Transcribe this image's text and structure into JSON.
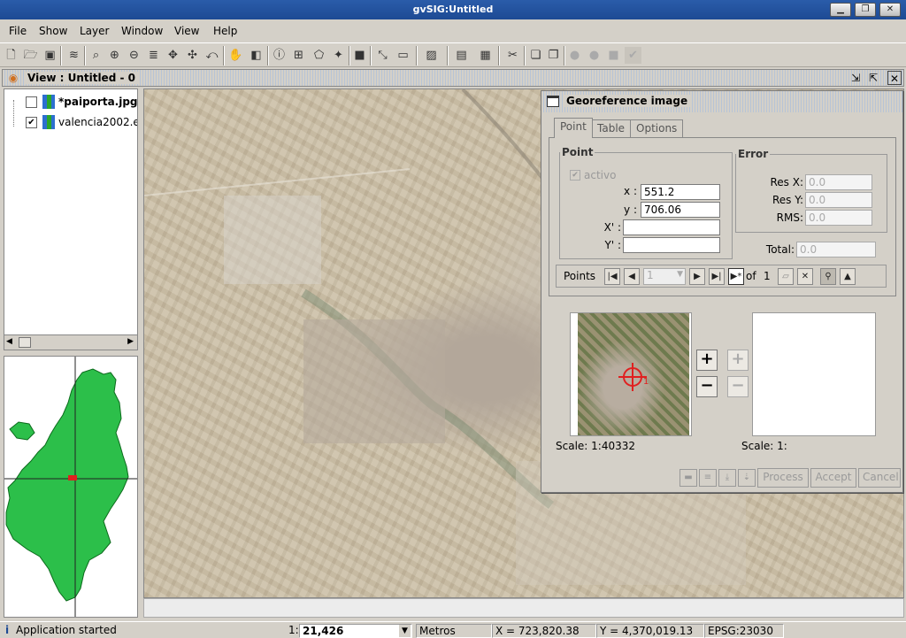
{
  "window": {
    "title": "gvSIG:Untitled",
    "controls": [
      "minimize-icon",
      "restore-icon",
      "close-icon"
    ]
  },
  "menu": {
    "items": [
      "File",
      "Show",
      "Layer",
      "Window",
      "View",
      "Help"
    ]
  },
  "view": {
    "title": "View : Untitled - 0"
  },
  "toc": {
    "layers": [
      {
        "name": "*paiporta.jpg",
        "checked": false,
        "bold": true
      },
      {
        "name": "valencia2002.e",
        "checked": true,
        "bold": false
      }
    ]
  },
  "georef": {
    "title": "Georeference image",
    "tabs": [
      "Point",
      "Table",
      "Options"
    ],
    "active_tab": "Point",
    "point": {
      "legend": "Point",
      "activo_label": "activo",
      "x_label": "x :",
      "x_value": "551.2",
      "y_label": "y :",
      "y_value": "706.06",
      "xp_label": "X' :",
      "xp_value": "",
      "yp_label": "Y' :",
      "yp_value": ""
    },
    "error": {
      "legend": "Error",
      "resx_label": "Res X:",
      "resx_value": "0.0",
      "resy_label": "Res Y:",
      "resy_value": "0.0",
      "rms_label": "RMS:",
      "rms_value": "0.0",
      "total_label": "Total:",
      "total_value": "0.0"
    },
    "points_bar": {
      "label": "Points",
      "current": "1",
      "of_label": "of",
      "total": "1"
    },
    "scale_left": "Scale:  1:40332",
    "scale_right": "Scale:  1:",
    "buttons": {
      "process": "Process",
      "accept": "Accept",
      "cancel": "Cancel"
    },
    "crosshair_label": "1"
  },
  "status": {
    "message": "Application started",
    "scale_prefix": "1:",
    "scale_value": "21,426",
    "units": "Metros",
    "x": "X = 723,820.38",
    "y": "Y = 4,370,019.13",
    "epsg": "EPSG:23030"
  },
  "colors": {
    "region_fill": "#2cbf4a",
    "title_blue": "#1d4a94",
    "crosshair": "#e02020"
  }
}
